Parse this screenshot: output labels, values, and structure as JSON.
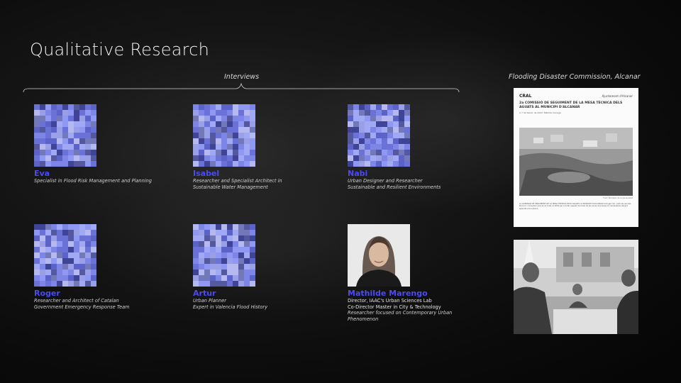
{
  "title": "Qualitative Research",
  "interviews_label": "Interviews",
  "commission_label": "Flooding Disaster Commission, Alcanar",
  "people": [
    {
      "name": "Eva",
      "lines": [
        "Specialist in Flood Risk Management and Planning"
      ]
    },
    {
      "name": "Isabel",
      "lines": [
        "Researcher and Specialist Architect in",
        "Sustainable Water Management"
      ]
    },
    {
      "name": "Nabi",
      "lines": [
        "Urban Designer and Researcher",
        "Sustainable and Resilient Environments"
      ]
    },
    {
      "name": "Roger",
      "lines": [
        "Researcher and Architect of Catalan",
        "Government Emergency Response Team"
      ]
    },
    {
      "name": "Artur",
      "lines": [
        "Urban Planner",
        "Expert in Valencia Flood History"
      ]
    },
    {
      "name": "Mathilde Marengo",
      "lines": [
        "Director, IAAC's Urban Sciences Lab",
        "Co-Director Master in City & Technology"
      ],
      "italic_lines": [
        "Researcher focused on Contemporary Urban",
        "Phenomenon"
      ]
    }
  ],
  "document": {
    "logo_left": "CRAL",
    "logo_right": "Ajuntament d'Alcanar",
    "heading": "2a COMISSIÓ DE SEGUIMENT DE LA MESA TÈCNICA DELS AGUATS AL MUNICIPI D'ALCANAR",
    "date": "A 7 de febrer de 2022, Mètode Càrrega",
    "caption": "Font: Bombers de la Generalitat",
    "body": "La COMISSIÓ DE SEGUIMENT DE LA MESA TÈCNICA DELS AGUATS AL MUNICIPI D'ALCANAR ha tingut lloc, amb els serveis tècnics i consultius que es va crear el 2019 per a dotar aquest municipi de les eines de prevenció necessàries davant episodis d'inundació."
  },
  "colors": {
    "accent": "#4b4bf0",
    "background": "#0e0e0e"
  }
}
